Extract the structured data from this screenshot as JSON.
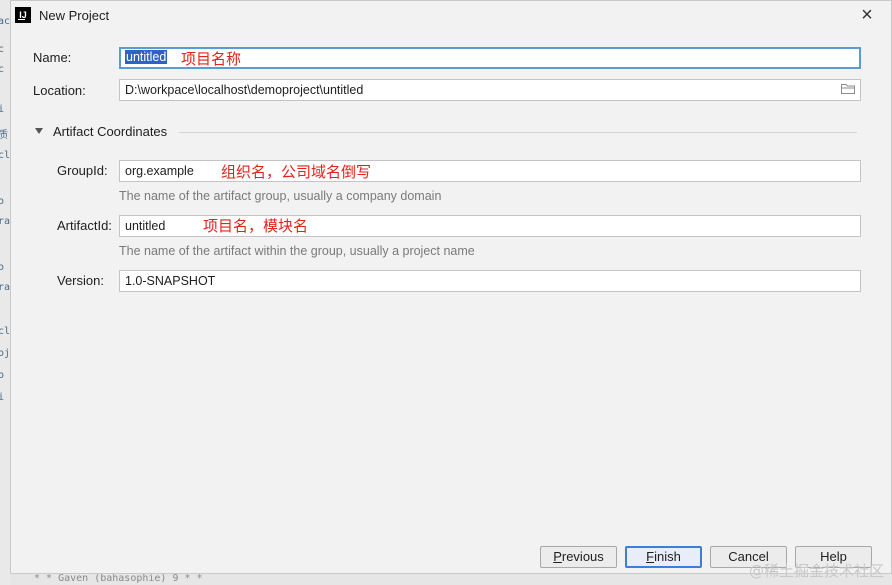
{
  "window": {
    "title": "New Project",
    "logo_text": "IJ"
  },
  "form": {
    "name": {
      "label": "Name:",
      "value": "untitled",
      "annotation": "项目名称"
    },
    "location": {
      "label": "Location:",
      "value": "D:\\workpace\\localhost\\demoproject\\untitled"
    },
    "section": {
      "title": "Artifact Coordinates",
      "expanded": true
    },
    "group_id": {
      "label": "GroupId:",
      "value": "org.example",
      "annotation": "组织名，公司域名倒写",
      "hint": "The name of the artifact group, usually a company domain"
    },
    "artifact_id": {
      "label": "ArtifactId:",
      "value": "untitled",
      "annotation": "项目名，模块名",
      "hint": "The name of the artifact within the group, usually a project name"
    },
    "version": {
      "label": "Version:",
      "value": "1.0-SNAPSHOT"
    }
  },
  "buttons": {
    "previous": {
      "mnemonic": "P",
      "rest": "revious"
    },
    "finish": {
      "mnemonic": "F",
      "rest": "inish"
    },
    "cancel": {
      "label": "Cancel"
    },
    "help": {
      "label": "Help"
    }
  },
  "watermark": "@稀土掘金技术社区",
  "colors": {
    "annotation": "#e5211b",
    "focus_border": "#5a9bd5",
    "selection": "#2e63c5"
  }
}
